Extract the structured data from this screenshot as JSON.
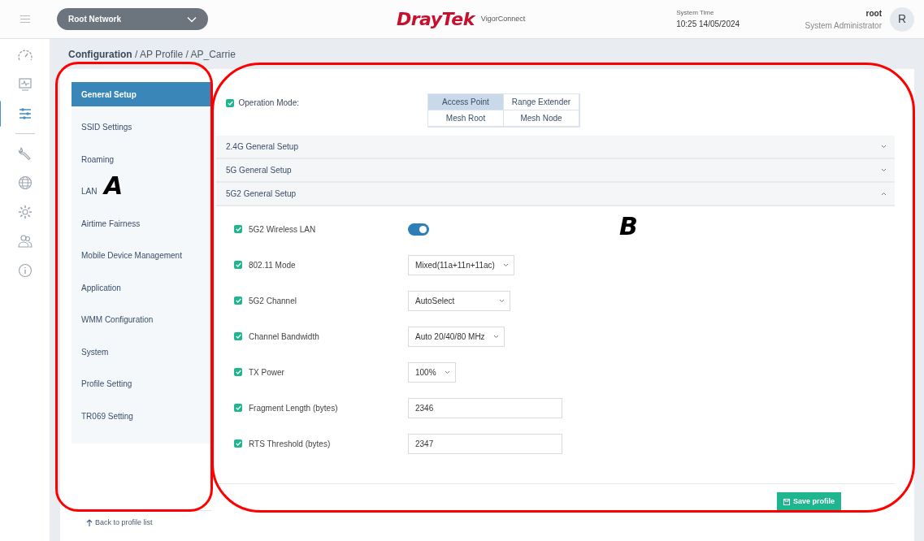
{
  "topbar": {
    "network_select": "Root Network",
    "brand": "DrayTek",
    "product": "VigorConnect",
    "system_time_label": "System Time",
    "system_time": "10:25 14/05/2024",
    "user": "root",
    "role": "System Administrator",
    "avatar": "R"
  },
  "nav_rail": [
    {
      "kind": "gauge",
      "selected": false
    },
    {
      "kind": "monitor",
      "selected": false
    },
    {
      "kind": "sliders",
      "selected": true
    },
    {
      "kind": "wrench",
      "selected": false
    },
    {
      "kind": "globe",
      "selected": false
    },
    {
      "kind": "gear",
      "selected": false
    },
    {
      "kind": "users",
      "selected": false
    },
    {
      "kind": "info",
      "selected": false
    }
  ],
  "breadcrumb": "**Configuration** / AP Profile / AP_Carrie",
  "menu": [
    {
      "label": "General Setup",
      "selected": true
    },
    {
      "label": "SSID Settings",
      "selected": false
    },
    {
      "label": "Roaming",
      "selected": false
    },
    {
      "label": "LAN",
      "selected": false
    },
    {
      "label": "Airtime Fairness",
      "selected": false
    },
    {
      "label": "Mobile Device Management",
      "selected": false
    },
    {
      "label": "Application",
      "selected": false
    },
    {
      "label": "WMM Configuration",
      "selected": false
    },
    {
      "label": "System",
      "selected": false
    },
    {
      "label": "Profile Setting",
      "selected": false
    },
    {
      "label": "TR069 Setting",
      "selected": false
    }
  ],
  "back_link": "Back to profile list",
  "operation_mode": {
    "label": "Operation Mode:",
    "checked": true,
    "options": [
      {
        "label": "Access Point",
        "selected": true
      },
      {
        "label": "Range Extender",
        "selected": false
      },
      {
        "label": "Mesh Root",
        "selected": false
      },
      {
        "label": "Mesh Node",
        "selected": false
      }
    ]
  },
  "sections": [
    {
      "title": "2.4G General Setup",
      "expanded": false
    },
    {
      "title": "5G General Setup",
      "expanded": false
    },
    {
      "title": "5G2 General Setup",
      "expanded": true
    }
  ],
  "fields": [
    {
      "kind": "toggle",
      "label": "5G2 Wireless LAN",
      "checked": true,
      "on": true
    },
    {
      "kind": "select",
      "label": "802.11 Mode",
      "checked": true,
      "value": "Mixed(11a+11n+11ac)"
    },
    {
      "kind": "select",
      "label": "5G2 Channel",
      "checked": true,
      "value": "AutoSelect"
    },
    {
      "kind": "select",
      "label": "Channel Bandwidth",
      "checked": true,
      "value": "Auto 20/40/80 MHz"
    },
    {
      "kind": "select",
      "label": "TX Power",
      "checked": true,
      "value": "100%"
    },
    {
      "kind": "text",
      "label": "Fragment Length (bytes)",
      "checked": true,
      "value": "2346"
    },
    {
      "kind": "text",
      "label": "RTS Threshold (bytes)",
      "checked": true,
      "value": "2347"
    }
  ],
  "save_button": "Save profile",
  "callouts": [
    {
      "label": "A"
    },
    {
      "label": "B"
    }
  ]
}
